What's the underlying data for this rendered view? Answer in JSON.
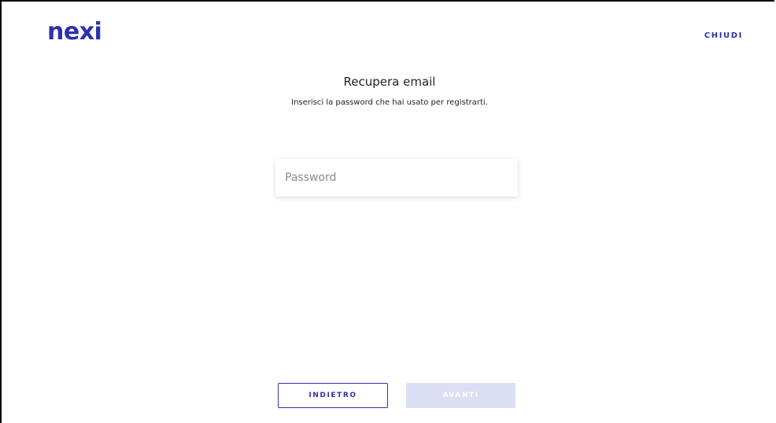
{
  "header": {
    "logo_text": "nexi",
    "close_label": "CHIUDI"
  },
  "main": {
    "title": "Recupera email",
    "subtitle": "Inserisci la password che hai usato per registrarti.",
    "password": {
      "placeholder": "Password",
      "value": ""
    }
  },
  "footer": {
    "back_label": "INDIETRO",
    "next_label": "AVANTI"
  },
  "colors": {
    "brand": "#2d32aa",
    "disabled_button": "#dcdef3"
  }
}
